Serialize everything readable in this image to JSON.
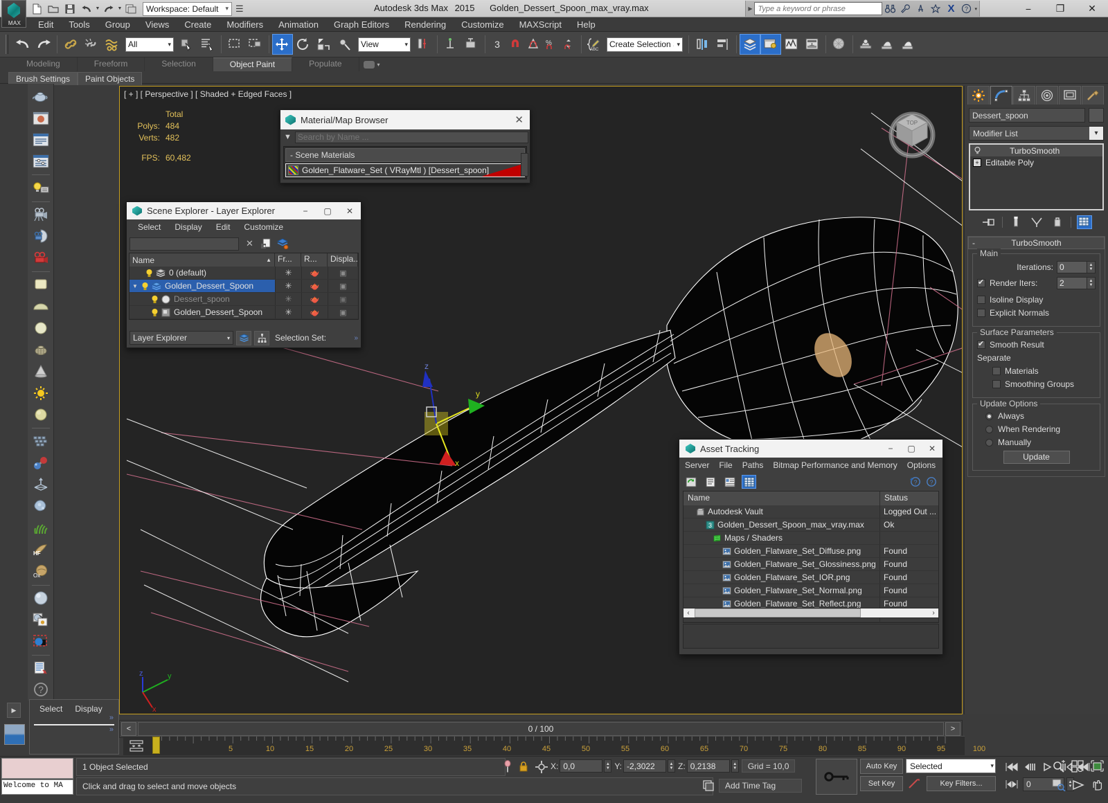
{
  "titlebar": {
    "app_name": "Autodesk 3ds Max",
    "version": "2015",
    "file_name": "Golden_Dessert_Spoon_max_vray.max",
    "workspace_label": "Workspace: Default",
    "search_placeholder": "Type a keyword or phrase",
    "quick_access": [
      "new-icon",
      "open-icon",
      "save-icon",
      "undo-icon",
      "redo-icon",
      "set-project-icon"
    ],
    "window_controls": [
      "minimize",
      "restore",
      "close"
    ],
    "help_icons": [
      "binoculars-icon",
      "wrench-icon",
      "compass-icon",
      "star-icon",
      "exchange-icon",
      "help-icon"
    ]
  },
  "menu": {
    "items": [
      "Edit",
      "Tools",
      "Group",
      "Views",
      "Create",
      "Modifiers",
      "Animation",
      "Graph Editors",
      "Rendering",
      "Customize",
      "MAXScript",
      "Help"
    ]
  },
  "toolbar": {
    "selection_filter": "All",
    "ref_coord_system": "View",
    "named_selection_sets": "Create Selection Se",
    "snap_angle": "3",
    "icons": [
      "undo-icon",
      "redo-icon",
      "select-link-icon",
      "unlink-icon",
      "bind-spacewarp-icon",
      "select-object-icon",
      "select-by-name-icon",
      "rect-select-region-icon",
      "window-crossing-icon",
      "select-and-move-icon",
      "select-and-rotate-icon",
      "select-and-scale-icon",
      "placement-icon",
      "use-center-icon",
      "select-and-manipulate-icon",
      "snaps-toggle-icon",
      "angle-snap-icon",
      "percent-snap-icon",
      "spinner-snap-icon",
      "edit-named-selection-icon",
      "mirror-icon",
      "align-icon",
      "layer-explorer-icon",
      "ribbon-toggle-icon",
      "curve-editor-icon",
      "schematic-view-icon",
      "material-editor-icon",
      "render-setup-icon",
      "rendered-frame-icon",
      "render-production-icon"
    ]
  },
  "ribbon": {
    "tabs": [
      {
        "label": "Modeling",
        "active": false
      },
      {
        "label": "Freeform",
        "active": false
      },
      {
        "label": "Selection",
        "active": false
      },
      {
        "label": "Object Paint",
        "active": true
      },
      {
        "label": "Populate",
        "active": false
      }
    ],
    "subtabs": [
      "Brush Settings",
      "Paint Objects"
    ]
  },
  "left_toolbar": {
    "icons": [
      "teapot-create-icon",
      "render-preview-icon",
      "dialog-list-icon",
      "dialog-sliders-icon",
      "light-lister-icon",
      "camera-icon",
      "camera-match-icon",
      "camera-red-icon",
      "box-primitive-icon",
      "hemisphere-icon",
      "sphere-icon",
      "teapot-wire-icon",
      "cone-icon",
      "omni-light-icon",
      "sphere-gold-icon",
      "array-icon",
      "atom-bond-icon",
      "normal-align-icon",
      "blobmesh-icon",
      "grass-icon",
      "hair-and-fur-icon",
      "ox-hair-icon",
      "sphere-preview-icon",
      "material-map-icon",
      "render-region-icon",
      "notes-icon",
      "help-icon"
    ]
  },
  "viewport": {
    "label": "[ + ] [ Perspective ] [ Shaded + Edged Faces ]",
    "stats": {
      "header": "Total",
      "rows": [
        {
          "label": "Polys:",
          "value": "484"
        },
        {
          "label": "Verts:",
          "value": "482"
        }
      ],
      "fps_label": "FPS:",
      "fps_value": "60,482"
    },
    "axis_labels": {
      "x": "x",
      "y": "y",
      "z": "z"
    },
    "viewcube_face": "TOP"
  },
  "material_browser": {
    "title": "Material/Map Browser",
    "search_placeholder": "Search by Name ...",
    "group_label": "- Scene Materials",
    "material": "Golden_Flatware_Set  ( VRayMtl ) [Dessert_spoon]"
  },
  "scene_explorer": {
    "title": "Scene Explorer - Layer Explorer",
    "menu": [
      "Select",
      "Display",
      "Edit",
      "Customize"
    ],
    "search_value": "",
    "columns": [
      "Name",
      "Fr...",
      "R...",
      "Displa..."
    ],
    "rows": [
      {
        "name": "0 (default)",
        "indent": 1,
        "selected": false,
        "dim": false,
        "icon": "layer-icon"
      },
      {
        "name": "Golden_Dessert_Spoon",
        "indent": 1,
        "selected": true,
        "dim": false,
        "icon": "layer-icon"
      },
      {
        "name": "Dessert_spoon",
        "indent": 2,
        "selected": false,
        "dim": true,
        "icon": "object-icon"
      },
      {
        "name": "Golden_Dessert_Spoon",
        "indent": 2,
        "selected": false,
        "dim": false,
        "icon": "group-icon"
      }
    ],
    "mode_combo": "Layer Explorer",
    "selection_set_label": "Selection Set:"
  },
  "asset_tracking": {
    "title": "Asset Tracking",
    "menu": [
      "Server",
      "File",
      "Paths",
      "Bitmap Performance and Memory",
      "Options"
    ],
    "toolbar_icons": [
      "refresh-icon",
      "list-view-icon",
      "detail-view-icon",
      "grid-view-icon"
    ],
    "columns": [
      "Name",
      "Status"
    ],
    "rows": [
      {
        "name": "Autodesk Vault",
        "status": "Logged Out ...",
        "indent": 1,
        "icon": "vault-icon"
      },
      {
        "name": "Golden_Dessert_Spoon_max_vray.max",
        "status": "Ok",
        "indent": 2,
        "icon": "max-file-icon"
      },
      {
        "name": "Maps / Shaders",
        "status": "",
        "indent": 2,
        "icon": "maps-icon"
      },
      {
        "name": "Golden_Flatware_Set_Diffuse.png",
        "status": "Found",
        "indent": 3,
        "icon": "bitmap-icon"
      },
      {
        "name": "Golden_Flatware_Set_Glossiness.png",
        "status": "Found",
        "indent": 3,
        "icon": "bitmap-icon"
      },
      {
        "name": "Golden_Flatware_Set_IOR.png",
        "status": "Found",
        "indent": 3,
        "icon": "bitmap-icon"
      },
      {
        "name": "Golden_Flatware_Set_Normal.png",
        "status": "Found",
        "indent": 3,
        "icon": "bitmap-icon"
      },
      {
        "name": "Golden_Flatware_Set_Reflect.png",
        "status": "Found",
        "indent": 3,
        "icon": "bitmap-icon"
      },
      {
        "name": "",
        "status": "",
        "indent": 1,
        "icon": ""
      }
    ]
  },
  "command_panel": {
    "tabs": [
      "create-tab-icon",
      "modify-tab-icon",
      "hierarchy-tab-icon",
      "motion-tab-icon",
      "display-tab-icon",
      "utilities-tab-icon"
    ],
    "active_tab_index": 1,
    "object_name": "Dessert_spoon",
    "modifier_list_label": "Modifier List",
    "stack": [
      {
        "label": "TurboSmooth",
        "selected": true
      },
      {
        "label": "Editable Poly",
        "selected": false
      }
    ],
    "stack_tools": [
      "pin-stack-icon",
      "show-end-result-icon",
      "make-unique-icon",
      "remove-modifier-icon",
      "configure-sets-icon"
    ],
    "rollout": {
      "title": "TurboSmooth",
      "collapse_sign": "-",
      "main_group": "Main",
      "iterations_label": "Iterations:",
      "iterations_value": "0",
      "render_iters_label": "Render Iters:",
      "render_iters_value": "2",
      "render_iters_checked": true,
      "isoline_label": "Isoline Display",
      "isoline_checked": false,
      "explicit_label": "Explicit Normals",
      "explicit_checked": false,
      "surface_group": "Surface Parameters",
      "smooth_result_label": "Smooth Result",
      "smooth_result_checked": true,
      "separate_label": "Separate",
      "materials_label": "Materials",
      "materials_checked": false,
      "smoothing_groups_label": "Smoothing Groups",
      "smoothing_groups_checked": false,
      "update_group": "Update Options",
      "update_options": [
        {
          "label": "Always",
          "selected": true
        },
        {
          "label": "When Rendering",
          "selected": false
        },
        {
          "label": "Manually",
          "selected": false
        }
      ],
      "update_button": "Update"
    }
  },
  "lower_left": {
    "menu": [
      "Select",
      "Display"
    ],
    "chevron": "»"
  },
  "timeline": {
    "frame_display": "0 / 100",
    "prev_arrow": "<",
    "next_arrow": ">",
    "ruler_ticks": [
      "5",
      "10",
      "15",
      "20",
      "25",
      "30",
      "35",
      "40",
      "45",
      "50",
      "55",
      "60",
      "65",
      "70",
      "75",
      "80",
      "85",
      "90",
      "95",
      "100"
    ],
    "current_frame": 0
  },
  "status_bar": {
    "maxscript_text": "Welcome to MA",
    "selection_status": "1 Object Selected",
    "prompt": "Click and drag to select and move objects",
    "coords": {
      "x_label": "X:",
      "x_value": "0,0",
      "y_label": "Y:",
      "y_value": "-2,3022",
      "z_label": "Z:",
      "z_value": "0,2138"
    },
    "grid_label": "Grid = 10,0",
    "add_time_tag": "Add Time Tag",
    "auto_key": "Auto Key",
    "set_key": "Set Key",
    "key_mode_combo": "Selected",
    "key_filters": "Key Filters...",
    "frame_value": "0",
    "playback_icons": [
      "go-to-start-icon",
      "previous-frame-icon",
      "play-animation-icon",
      "next-frame-icon",
      "go-to-end-icon"
    ],
    "nav_icons": [
      "zoom-icon",
      "zoom-all-icon",
      "zoom-extents-icon",
      "zoom-region-icon",
      "field-of-view-icon",
      "pan-icon",
      "orbit-icon",
      "maximize-viewport-icon"
    ]
  },
  "colors": {
    "accent_blue": "#2b6ec9",
    "viewport_border": "#c8a020",
    "stats_yellow": "#e3c15a",
    "panel_bg": "#3c3c3c",
    "titlebar_bg": "#d8d8d8",
    "selection_highlight": "#2b5fad"
  }
}
